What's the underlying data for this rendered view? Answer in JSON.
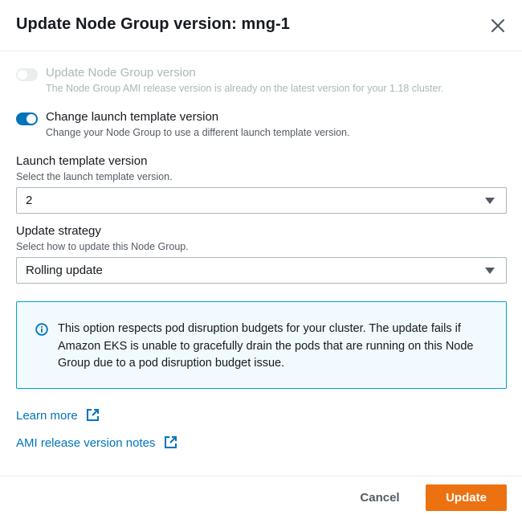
{
  "header": {
    "title": "Update Node Group version: mng-1"
  },
  "toggles": [
    {
      "label": "Update Node Group version",
      "description": "The Node Group AMI release version is already on the latest version for your 1.18 cluster.",
      "checked": false,
      "disabled": true
    },
    {
      "label": "Change launch template version",
      "description": "Change your Node Group to use a different launch template version.",
      "checked": true,
      "disabled": false
    }
  ],
  "launch_template": {
    "label": "Launch template version",
    "description": "Select the launch template version.",
    "value": "2"
  },
  "update_strategy": {
    "label": "Update strategy",
    "description": "Select how to update this Node Group.",
    "value": "Rolling update"
  },
  "info": {
    "text": "This option respects pod disruption budgets for your cluster. The update fails if Amazon EKS is unable to gracefully drain the pods that are running on this Node Group due to a pod disruption budget issue."
  },
  "links": {
    "learn_more": "Learn more",
    "ami_notes": "AMI release version notes"
  },
  "footer": {
    "cancel_label": "Cancel",
    "update_label": "Update"
  },
  "colors": {
    "primary": "#ec7211",
    "link": "#0073bb",
    "toggle_on": "#0073bb",
    "info_border": "#00a1c9",
    "info_bg": "#f1faff"
  },
  "icons": {
    "close": "close-icon",
    "info": "info-icon",
    "external": "external-link-icon",
    "caret": "caret-down-icon"
  }
}
